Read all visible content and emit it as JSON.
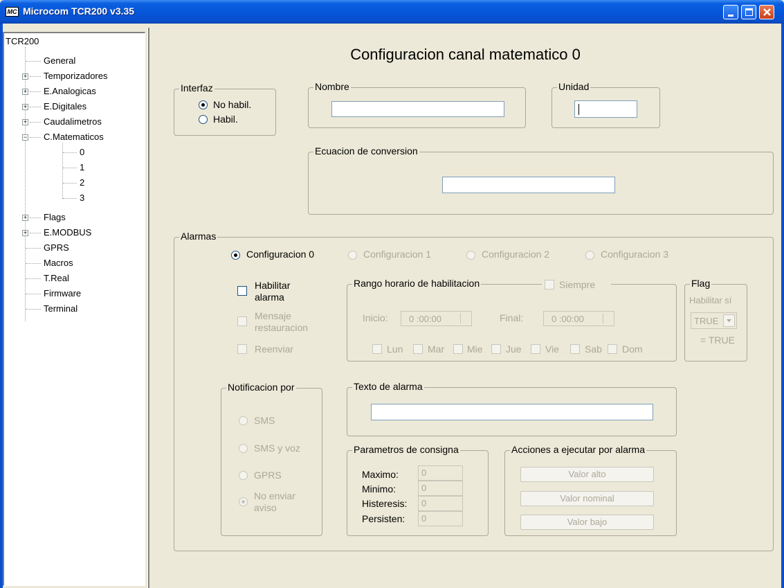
{
  "window": {
    "title": "Microcom TCR200 v3.35",
    "icon": "app-logo-icon"
  },
  "tree": {
    "root": "TCR200",
    "items": [
      {
        "label": "General"
      },
      {
        "label": "Temporizadores"
      },
      {
        "label": "E.Analogicas"
      },
      {
        "label": "E.Digitales"
      },
      {
        "label": "Caudalimetros"
      },
      {
        "label": "C.Matematicos"
      },
      {
        "label": "0"
      },
      {
        "label": "1"
      },
      {
        "label": "2"
      },
      {
        "label": "3"
      },
      {
        "label": "Flags"
      },
      {
        "label": "E.MODBUS"
      },
      {
        "label": "GPRS"
      },
      {
        "label": "Macros"
      },
      {
        "label": "T.Real"
      },
      {
        "label": "Firmware"
      },
      {
        "label": "Terminal"
      }
    ]
  },
  "main": {
    "heading": "Configuracion canal matematico  0",
    "interfaz": {
      "legend": "Interfaz",
      "options": [
        "No habil.",
        "Habil."
      ],
      "selected": "No habil."
    },
    "nombre": {
      "legend": "Nombre",
      "value": ""
    },
    "unidad": {
      "legend": "Unidad",
      "value": ""
    },
    "ecuacion": {
      "legend": "Ecuacion de conversion",
      "value": ""
    },
    "alarmas": {
      "legend": "Alarmas",
      "configs": [
        "Configuracion 0",
        "Configuracion 1",
        "Configuracion 2",
        "Configuracion 3"
      ],
      "selected_config": "Configuracion 0",
      "habilitar_alarma": "Habilitar alarma",
      "habilitar_1": "Habilitar",
      "habilitar_2": "alarma",
      "mensaje_1": "Mensaje",
      "mensaje_2": "restauracion",
      "reenviar": "Reenviar",
      "rango": {
        "legend": "Rango horario de habilitacion",
        "siempre": "Siempre",
        "inicio_label": "Inicio:",
        "inicio_value": "0 :00:00",
        "final_label": "Final:",
        "final_value": "0 :00:00",
        "days": [
          "Lun",
          "Mar",
          "Mie",
          "Jue",
          "Vie",
          "Sab",
          "Dom"
        ]
      },
      "flag": {
        "legend": "Flag",
        "habilitar": "Habilitar sí",
        "select_value": "TRUE",
        "equals": "= TRUE"
      },
      "notificacion": {
        "legend": "Notificacion por",
        "options": [
          "SMS",
          "SMS y voz",
          "GPRS"
        ],
        "no_enviar_1": "No enviar",
        "no_enviar_2": "aviso",
        "selected": "No enviar aviso"
      },
      "texto_alarma": {
        "legend": "Texto de alarma",
        "value": ""
      },
      "parametros": {
        "legend": "Parametros de consigna",
        "fields": [
          {
            "label": "Maximo:",
            "value": "0"
          },
          {
            "label": "Minimo:",
            "value": "0"
          },
          {
            "label": "Histeresis:",
            "value": "0"
          },
          {
            "label": "Persisten:",
            "value": "0"
          }
        ]
      },
      "acciones": {
        "legend": "Acciones a ejecutar por alarma",
        "buttons": [
          "Valor alto",
          "Valor nominal",
          "Valor bajo"
        ]
      }
    }
  },
  "colors": {
    "titlebar": "#0654d8",
    "background": "#ece9d8",
    "disabled_text": "#aca899",
    "close_button": "#c8401a"
  }
}
